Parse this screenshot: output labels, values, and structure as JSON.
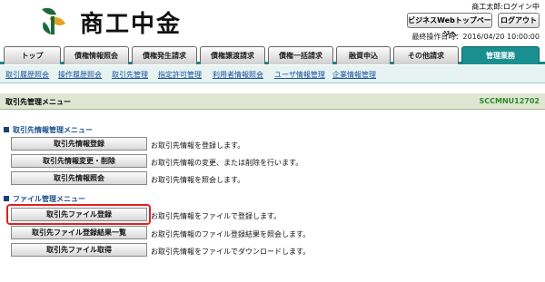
{
  "header": {
    "logo_text": "商工中金",
    "user_status": "商工太郎:ログイン中",
    "topp_button": "ビジネスWebトップページへ",
    "logout_button": "ログアウト",
    "last_operation": "最終操作日時：2016/04/20 10:00:00",
    "logo_colors": {
      "primary": "#1a6b3a",
      "accent": "#e8a020"
    }
  },
  "tabs": [
    {
      "label": "トップ"
    },
    {
      "label": "債権情報照会"
    },
    {
      "label": "債権発生請求"
    },
    {
      "label": "債権譲渡請求"
    },
    {
      "label": "債権一括請求"
    },
    {
      "label": "融資申込"
    },
    {
      "label": "その他請求"
    },
    {
      "label": "管理業務"
    }
  ],
  "active_tab": "管理業務",
  "subnav": [
    {
      "label": "取引履歴照会"
    },
    {
      "label": "操作履歴照会"
    },
    {
      "label": "取引先管理"
    },
    {
      "label": "指定許可管理"
    },
    {
      "label": "利用者情報照会"
    },
    {
      "label": "ユーザ情報管理"
    },
    {
      "label": "企業情報管理"
    }
  ],
  "page": {
    "title": "取引先管理メニュー",
    "code": "SCCMNU12702"
  },
  "sections": {
    "info": {
      "heading": "取引先情報管理メニュー",
      "items": [
        {
          "button": "取引先情報登録",
          "desc": "お取引先情報を登録します。"
        },
        {
          "button": "取引先情報変更・削除",
          "desc": "お取引先情報の変更、または削除を行います。"
        },
        {
          "button": "取引先情報照会",
          "desc": "お取引先情報を照会します。"
        }
      ]
    },
    "file": {
      "heading": "ファイル管理メニュー",
      "items": [
        {
          "button": "取引先ファイル登録",
          "desc": "お取引先情報をファイルで登録します。"
        },
        {
          "button": "取引先ファイル登録結果一覧",
          "desc": "お取引先情報のファイル登録結果を照会します。"
        },
        {
          "button": "取引先ファイル取得",
          "desc": "お取引先情報をファイルでダウンロードします。"
        }
      ]
    }
  },
  "colors": {
    "tab_active": "#1a8f8f",
    "highlight": "#e02020",
    "link": "#1a4fa0",
    "code": "#2a8a2a"
  }
}
